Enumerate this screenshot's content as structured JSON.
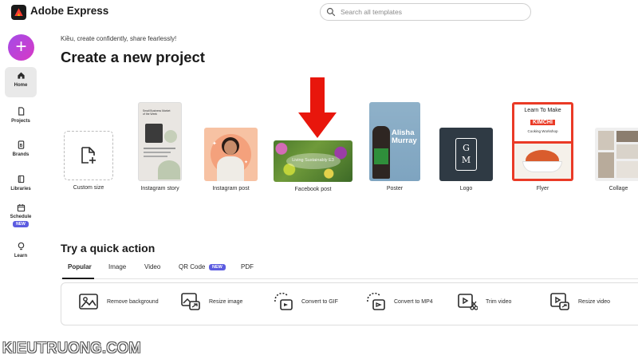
{
  "app": {
    "title": "Adobe Express"
  },
  "search": {
    "placeholder": "Search all templates"
  },
  "sidebar": {
    "create_label": "+",
    "items": [
      {
        "label": "Home",
        "icon": "home-icon",
        "active": true
      },
      {
        "label": "Projects",
        "icon": "document-icon"
      },
      {
        "label": "Brands",
        "icon": "brand-icon"
      },
      {
        "label": "Libraries",
        "icon": "library-icon"
      },
      {
        "label": "Schedule",
        "icon": "calendar-icon",
        "badge": "NEW"
      },
      {
        "label": "Learn",
        "icon": "lightbulb-icon"
      }
    ]
  },
  "main": {
    "tagline": "Kiều, create confidently, share fearlessly!",
    "title": "Create a new project",
    "templates": [
      {
        "label": "Custom size"
      },
      {
        "label": "Instagram story",
        "thumb_text": [
          "Small Business Market",
          "of the Week"
        ]
      },
      {
        "label": "Instagram post"
      },
      {
        "label": "Facebook post",
        "thumb_text": "Living Sustainably E3"
      },
      {
        "label": "Poster",
        "thumb_text": [
          "Alisha",
          "Murray"
        ]
      },
      {
        "label": "Logo",
        "thumb_text": [
          "G",
          "M"
        ]
      },
      {
        "label": "Flyer",
        "thumb_text": [
          "Learn To Make",
          "KIMCHI",
          "Cooking Workshop"
        ]
      },
      {
        "label": "Collage"
      }
    ]
  },
  "quick_actions": {
    "title": "Try a quick action",
    "tabs": [
      {
        "label": "Popular",
        "active": true
      },
      {
        "label": "Image"
      },
      {
        "label": "Video"
      },
      {
        "label": "QR Code",
        "badge": "NEW"
      },
      {
        "label": "PDF"
      }
    ],
    "actions": [
      {
        "label": "Remove background",
        "icon": "remove-background-icon"
      },
      {
        "label": "Resize image",
        "icon": "resize-image-icon"
      },
      {
        "label": "Convert to GIF",
        "icon": "convert-gif-icon"
      },
      {
        "label": "Convert to MP4",
        "icon": "convert-mp4-icon"
      },
      {
        "label": "Trim video",
        "icon": "trim-video-icon"
      },
      {
        "label": "Resize video",
        "icon": "resize-video-icon"
      }
    ]
  },
  "watermark": "KIEUTRUONG.COM",
  "colors": {
    "create_gradient_start": "#a34ce8",
    "create_gradient_end": "#d838c5",
    "new_badge": "#5c5ce0",
    "arrow": "#e8160c",
    "flyer_red": "#ea3a26"
  }
}
